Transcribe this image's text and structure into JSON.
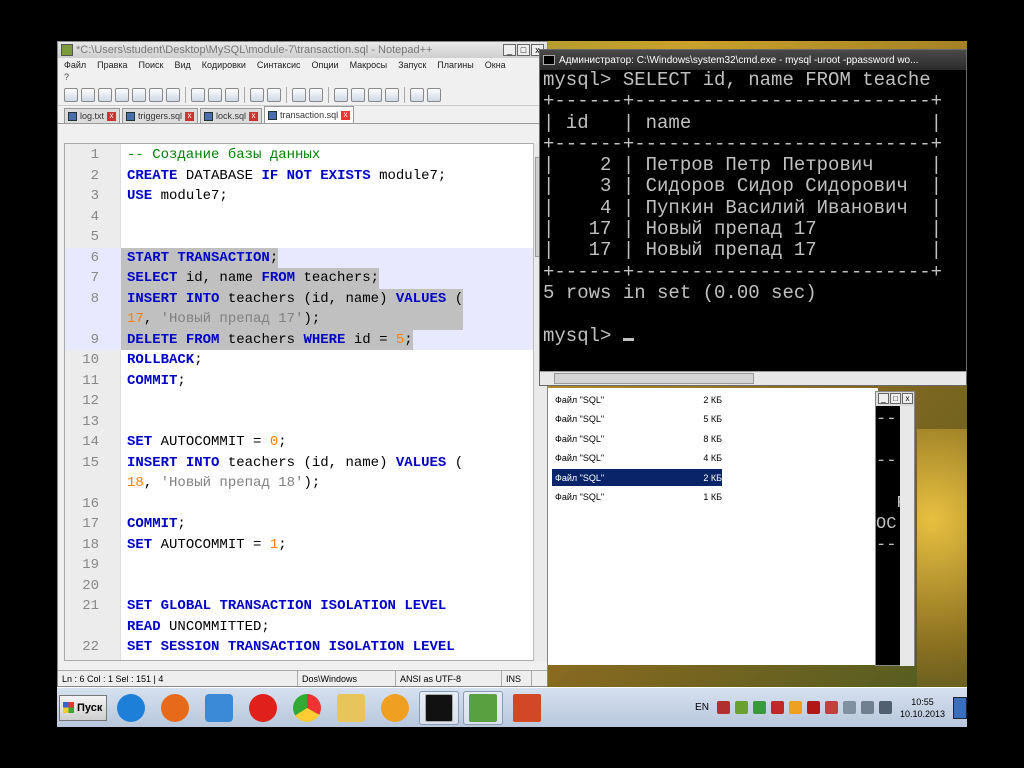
{
  "npp": {
    "title": "*C:\\Users\\student\\Desktop\\MySQL\\module-7\\transaction.sql - Notepad++",
    "menu": [
      "Файл",
      "Правка",
      "Поиск",
      "Вид",
      "Кодировки",
      "Синтаксис",
      "Опции",
      "Макросы",
      "Запуск",
      "Плагины",
      "Окна"
    ],
    "menu_extra": "?",
    "tabs": [
      "log.txt",
      "triggers.sql",
      "lock.sql",
      "transaction.sql"
    ],
    "line_numbers": [
      "1",
      "2",
      "3",
      "4",
      "5",
      "6",
      "7",
      "8",
      "9",
      "10",
      "11",
      "12",
      "13",
      "14",
      "15",
      "16",
      "17",
      "18",
      "19",
      "20",
      "21",
      "22"
    ],
    "status": {
      "pos": "Ln : 6    Col : 1    Sel : 151 | 4",
      "eol": "Dos\\Windows",
      "encoding": "ANSI as UTF-8",
      "mode": "INS"
    }
  },
  "cmd": {
    "title": "Администратор: C:\\Windows\\system32\\cmd.exe - mysql  -uroot -ppassword wo...",
    "lines": [
      "mysql> SELECT id, name FROM teache",
      "+------+--------------------------+",
      "| id   | name                     |",
      "+------+--------------------------+",
      "|    2 | Петров Петр Петрович     |",
      "|    3 | Сидоров Сидор Сидорович  |",
      "|    4 | Пупкин Василий Иванович  |",
      "|   17 | Новый препад 17          |",
      "|   17 | Новый препад 17          |",
      "+------+--------------------------+",
      "5 rows in set (0.00 sec)",
      "",
      "mysql> "
    ]
  },
  "files": [
    {
      "name": "Файл \"SQL\"",
      "size": "2 КБ"
    },
    {
      "name": "Файл \"SQL\"",
      "size": "5 КБ"
    },
    {
      "name": "Файл \"SQL\"",
      "size": "8 КБ"
    },
    {
      "name": "Файл \"SQL\"",
      "size": "4 КБ"
    },
    {
      "name": "Файл \"SQL\"",
      "size": "2 КБ"
    },
    {
      "name": "Файл \"SQL\"",
      "size": "1 КБ"
    }
  ],
  "cmd2": {
    "lines": [
      "--",
      "",
      "--",
      "",
      "  F",
      "OC",
      "--",
      ""
    ]
  },
  "taskbar": {
    "start": "Пуск",
    "lang": "EN",
    "time": "10:55",
    "date": "10.10.2013",
    "colors": {
      "ie": "#1e7fd8",
      "firefox": "#e66a1a",
      "vlc": "#3a8ad8",
      "opera": "#e0201a",
      "chrome": "#3fa34a",
      "folder": "#e8c55a",
      "flower": "#f0a020",
      "cmd": "#111111",
      "edit": "#58a040",
      "ppt": "#d24726"
    }
  }
}
